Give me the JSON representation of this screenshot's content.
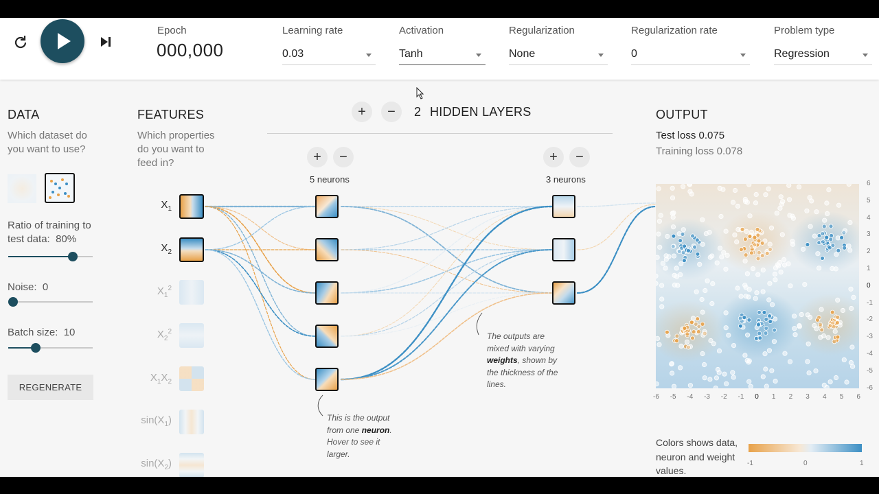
{
  "controls": {
    "epoch_label": "Epoch",
    "epoch_value": "000,000",
    "learning_rate": {
      "label": "Learning rate",
      "value": "0.03"
    },
    "activation": {
      "label": "Activation",
      "value": "Tanh"
    },
    "regularization": {
      "label": "Regularization",
      "value": "None"
    },
    "regularization_rate": {
      "label": "Regularization rate",
      "value": "0"
    },
    "problem_type": {
      "label": "Problem type",
      "value": "Regression"
    }
  },
  "data_panel": {
    "title": "DATA",
    "subtitle": "Which dataset do you want to use?",
    "ratio_label": "Ratio of training to test data:",
    "ratio_value": "80%",
    "ratio_fraction": 0.8,
    "noise_label": "Noise:",
    "noise_value": "0",
    "noise_fraction": 0.0,
    "batch_label": "Batch size:",
    "batch_value": "10",
    "batch_fraction": 0.3,
    "regenerate_label": "REGENERATE"
  },
  "features_panel": {
    "title": "FEATURES",
    "subtitle": "Which properties do you want to feed in?",
    "features": [
      {
        "base": "X",
        "sub": "1",
        "sup": "",
        "active": true
      },
      {
        "base": "X",
        "sub": "2",
        "sup": "",
        "active": true
      },
      {
        "base": "X",
        "sub": "1",
        "sup": "2",
        "active": false
      },
      {
        "base": "X",
        "sub": "2",
        "sup": "2",
        "active": false
      },
      {
        "base": "X1X2",
        "sub": "",
        "sup": "",
        "active": false
      },
      {
        "base": "sin(X1)",
        "sub": "",
        "sup": "",
        "active": false
      },
      {
        "base": "sin(X2)",
        "sub": "",
        "sup": "",
        "active": false
      }
    ]
  },
  "network": {
    "hidden_count": "2",
    "hidden_label": "HIDDEN LAYERS",
    "layer1_label": "5 neurons",
    "layer2_label": "3 neurons",
    "annotation_neuron_pre": "This is the output from one",
    "annotation_neuron_bold": "neuron",
    "annotation_neuron_post": ". Hover to see it larger.",
    "annotation_weights_pre": "The outputs are mixed with varying",
    "annotation_weights_bold": "weights",
    "annotation_weights_post": ", shown by the thickness of the lines."
  },
  "output_panel": {
    "title": "OUTPUT",
    "test_loss": "Test loss 0.075",
    "training_loss": "Training loss 0.078",
    "x_ticks": [
      "-6",
      "-5",
      "-4",
      "-3",
      "-2",
      "-1",
      "0",
      "1",
      "2",
      "3",
      "4",
      "5",
      "6"
    ],
    "y_ticks": [
      "6",
      "5",
      "4",
      "3",
      "2",
      "1",
      "0",
      "-1",
      "-2",
      "-3",
      "-4",
      "-5",
      "-6"
    ],
    "legend_text": "Colors shows data, neuron and weight values.",
    "colorbar_ticks": [
      "-1",
      "0",
      "1"
    ]
  },
  "colors": {
    "accent": "#1d4e5f",
    "positive": "#3c8fc4",
    "negative": "#e8a24a"
  }
}
